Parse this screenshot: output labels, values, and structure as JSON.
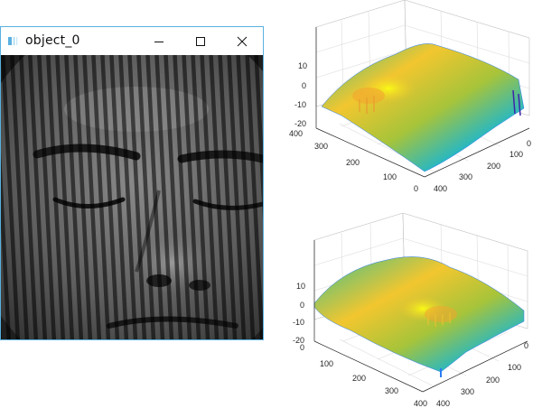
{
  "window": {
    "title": "object_0",
    "controls": {
      "minimize": "minimize-icon",
      "maximize": "maximize-icon",
      "close": "close-icon"
    },
    "accent_color": "#5ab0e0"
  },
  "plots": [
    {
      "z_ticks": [
        "10",
        "0",
        "-10",
        "-20"
      ],
      "y_ticks": [
        "400",
        "300",
        "200",
        "100",
        "0"
      ],
      "x_ticks": [
        "0",
        "100",
        "200",
        "300",
        "400"
      ],
      "x_label": "",
      "y_label": ""
    },
    {
      "z_ticks": [
        "10",
        "0",
        "-10",
        "-20"
      ],
      "y_ticks": [
        "0",
        "100",
        "200",
        "300",
        "400"
      ],
      "x_ticks": [
        "0",
        "100",
        "200",
        "300",
        "400"
      ],
      "x_label": "",
      "y_label": ""
    }
  ],
  "colormap": [
    "#3e26a8",
    "#2c7bf5",
    "#13b6d8",
    "#3cc08e",
    "#a7c43a",
    "#f2c62f",
    "#f9fb15"
  ]
}
